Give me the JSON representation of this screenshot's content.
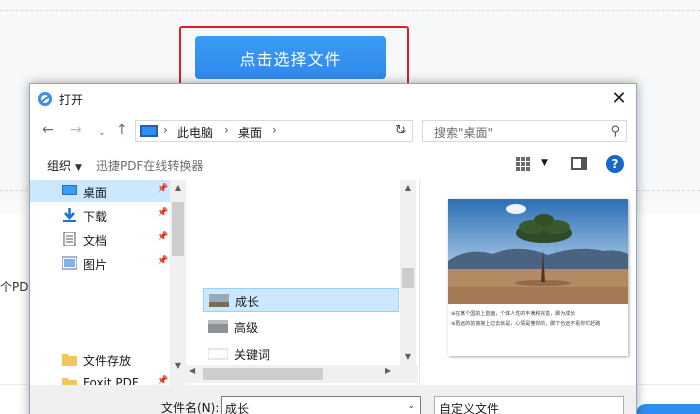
{
  "page": {
    "select_button_label": "点击选择文件",
    "side_text": "个PD"
  },
  "dialog": {
    "title": "打开",
    "close_glyph": "✕",
    "address": {
      "segments": [
        "此电脑",
        "桌面"
      ],
      "separator": "›"
    },
    "search": {
      "placeholder": "搜索\"桌面\""
    },
    "commands": {
      "organize": "组织",
      "convert": "迅捷PDF在线转换器"
    },
    "nav_items": [
      {
        "label": "桌面",
        "icon": "desktop-icon",
        "pinned": true,
        "selected": true
      },
      {
        "label": "下载",
        "icon": "download-icon",
        "pinned": true
      },
      {
        "label": "文档",
        "icon": "document-icon",
        "pinned": true
      },
      {
        "label": "图片",
        "icon": "picture-icon",
        "pinned": true
      },
      {
        "label": "文件存放",
        "icon": "folder-icon",
        "pinned": false
      },
      {
        "label": "Foxit PDF Editor",
        "icon": "folder-icon",
        "pinned": false
      }
    ],
    "files": [
      {
        "label": "成长",
        "selected": true
      },
      {
        "label": "高级"
      },
      {
        "label": "关键词"
      }
    ],
    "preview": {
      "lines": [
        "⊕在某个国前上首面，个体人性的丰满和完善，脚为成长",
        "⊕再远的前接接上过去就是，心情是懂你的，脚下也远不看你忙赶路"
      ]
    },
    "filename_label": "文件名(N):",
    "filename_value": "成长",
    "filetype_value": "自定义文件"
  },
  "colors": {
    "accent_blue": "#2f89ee",
    "highlight_red": "#e02020",
    "selection": "#cce8ff"
  }
}
